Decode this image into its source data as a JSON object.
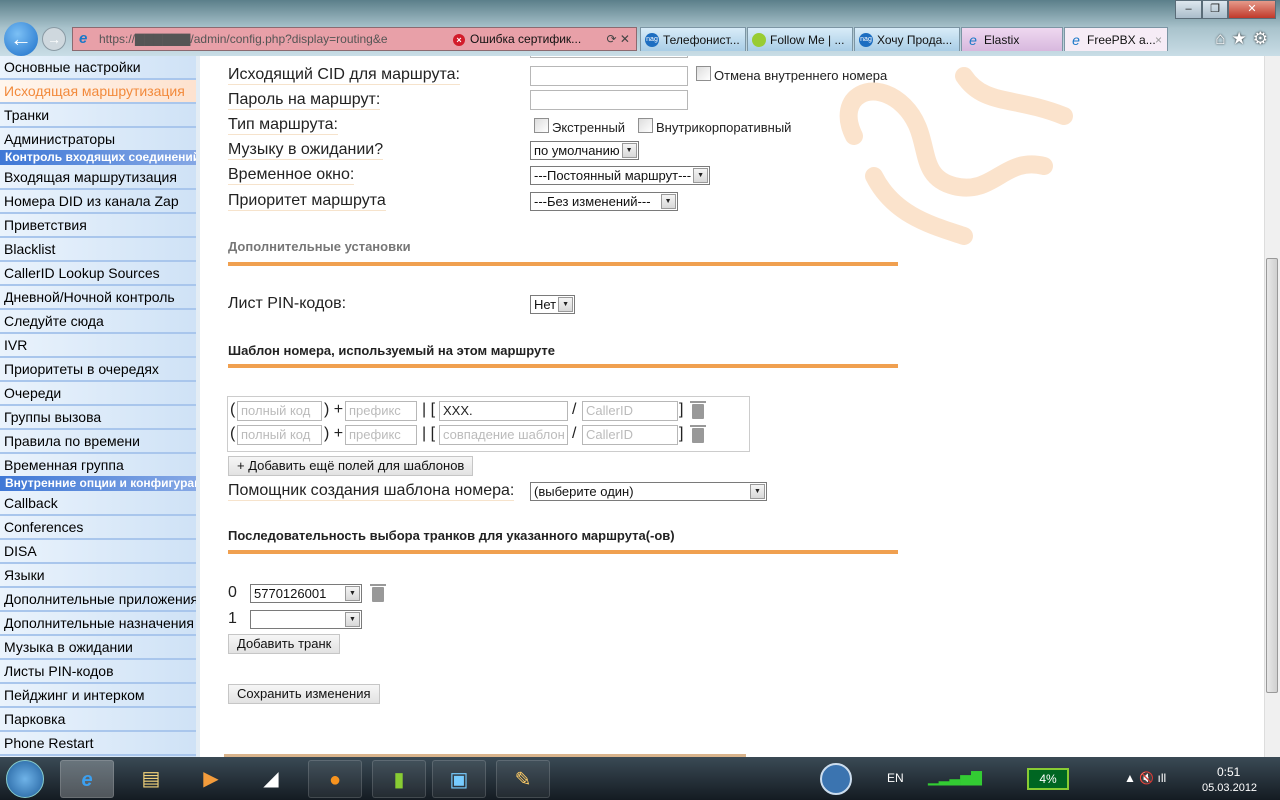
{
  "browser": {
    "address": "https://▇▇▇▇▇▇/admin/config.php?display=routing&e",
    "cert_error": "Ошибка сертифик...",
    "tabs": [
      {
        "label": "Телефонист...",
        "icon": "nag-icon"
      },
      {
        "label": "Follow Me | ...",
        "icon": "android-icon"
      },
      {
        "label": "Хочу Прода...",
        "icon": "nag-icon"
      },
      {
        "label": "Elastix",
        "icon": "ie-icon"
      },
      {
        "label": "FreePBX a...",
        "icon": "ie-icon",
        "active": true
      }
    ]
  },
  "sidebar": {
    "items": [
      {
        "label": "Основные настройки"
      },
      {
        "label": "Исходящая маршрутизация",
        "active": true
      },
      {
        "label": "Транки"
      },
      {
        "label": "Администраторы"
      },
      {
        "header": "Контроль входящих соединений"
      },
      {
        "label": "Входящая маршрутизация"
      },
      {
        "label": "Номера DID из канала Zap"
      },
      {
        "label": "Приветствия"
      },
      {
        "label": "Blacklist"
      },
      {
        "label": "CallerID Lookup Sources"
      },
      {
        "label": "Дневной/Ночной контроль"
      },
      {
        "label": "Следуйте сюда"
      },
      {
        "label": "IVR"
      },
      {
        "label": "Приоритеты в очередях"
      },
      {
        "label": "Очереди"
      },
      {
        "label": "Группы вызова"
      },
      {
        "label": "Правила по времени"
      },
      {
        "label": "Временная группа"
      },
      {
        "header": "Внутренние опции и конфигурация"
      },
      {
        "label": "Callback"
      },
      {
        "label": "Conferences"
      },
      {
        "label": "DISA"
      },
      {
        "label": "Языки"
      },
      {
        "label": "Дополнительные приложения"
      },
      {
        "label": "Дополнительные назначения"
      },
      {
        "label": "Музыка в ожидании"
      },
      {
        "label": "Листы PIN-кодов"
      },
      {
        "label": "Пейджинг и интерком"
      },
      {
        "label": "Парковка"
      },
      {
        "label": "Phone Restart"
      }
    ]
  },
  "form": {
    "cid_label": "Исходящий CID для маршрута:",
    "cid_value": "",
    "override_ext": "Отмена внутреннего номера",
    "password_label": "Пароль на маршрут:",
    "password_value": "",
    "type_label": "Тип маршрута:",
    "type_emergency": "Экстренный",
    "type_intracompany": "Внутрикорпоративный",
    "moh_label": "Музыку в ожидании?",
    "moh_value": "по умолчанию",
    "time_label": "Временное окно:",
    "time_value": "---Постоянный маршрут---",
    "priority_label": "Приоритет маршрута",
    "priority_value": "---Без изменений---",
    "additional_section": "Дополнительные установки",
    "pin_label": "Лист PIN-кодов:",
    "pin_value": "Нет",
    "pattern_section": "Шаблон номера, используемый на этом маршруте",
    "patterns": [
      {
        "prepend": "полный код",
        "prefix": "префикс",
        "match": "XXX.",
        "match_ph": "",
        "callerid": "CallerID"
      },
      {
        "prepend": "полный код",
        "prefix": "префикс",
        "match": "",
        "match_ph": "совпадение шаблон",
        "callerid": "CallerID"
      }
    ],
    "add_patterns": "+ Добавить ещё полей для шаблонов",
    "wizard_label": "Помощник создания шаблона номера:",
    "wizard_value": "(выберите один)",
    "trunk_section": "Последовательность выбора транков для указанного маршрута(-ов)",
    "trunks": [
      {
        "index": "0",
        "value": "5770126001"
      },
      {
        "index": "1",
        "value": ""
      }
    ],
    "add_trunk": "Добавить транк",
    "save": "Сохранить изменения"
  },
  "taskbar": {
    "lang": "EN",
    "battery": "4%",
    "time": "0:51",
    "date": "05.03.2012"
  },
  "colors": {
    "accent": "#f0a050",
    "active_nav": "#f28a3c",
    "nav_header": "#3f78d6"
  }
}
